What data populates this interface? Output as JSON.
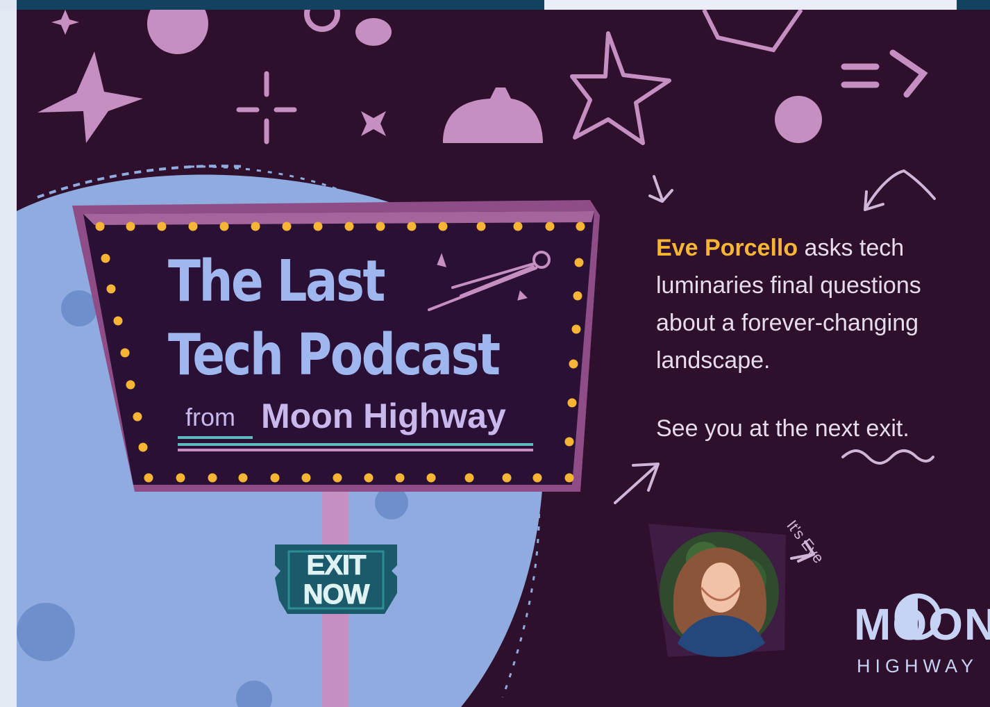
{
  "banner": {
    "sign": {
      "title_line_1": "The Last",
      "title_line_2": "Tech Podcast",
      "from": "from",
      "brand": "Moon Highway"
    },
    "exit_sign": {
      "line_1": "EXIT",
      "line_2": "NOW"
    },
    "description": {
      "host_name": "Eve Porcello",
      "body": " asks tech luminaries final questions about a forever-changing landscape."
    },
    "tagline": "See you at the next exit.",
    "host_label": "It's Eve",
    "logo": {
      "word": "MOON",
      "sub": "HIGHWAY"
    }
  },
  "colors": {
    "background": "#2e0f2c",
    "moon": "#8fabe0",
    "sign_face": "#2b1035",
    "sign_frame": "#8e4d87",
    "bulb": "#f6b535",
    "title_text": "#9fb6ee",
    "brand_text": "#c9b8ec",
    "host_name": "#f6b535",
    "doodle": "#c58fc2",
    "exit_sign": "#1a5a6a"
  }
}
